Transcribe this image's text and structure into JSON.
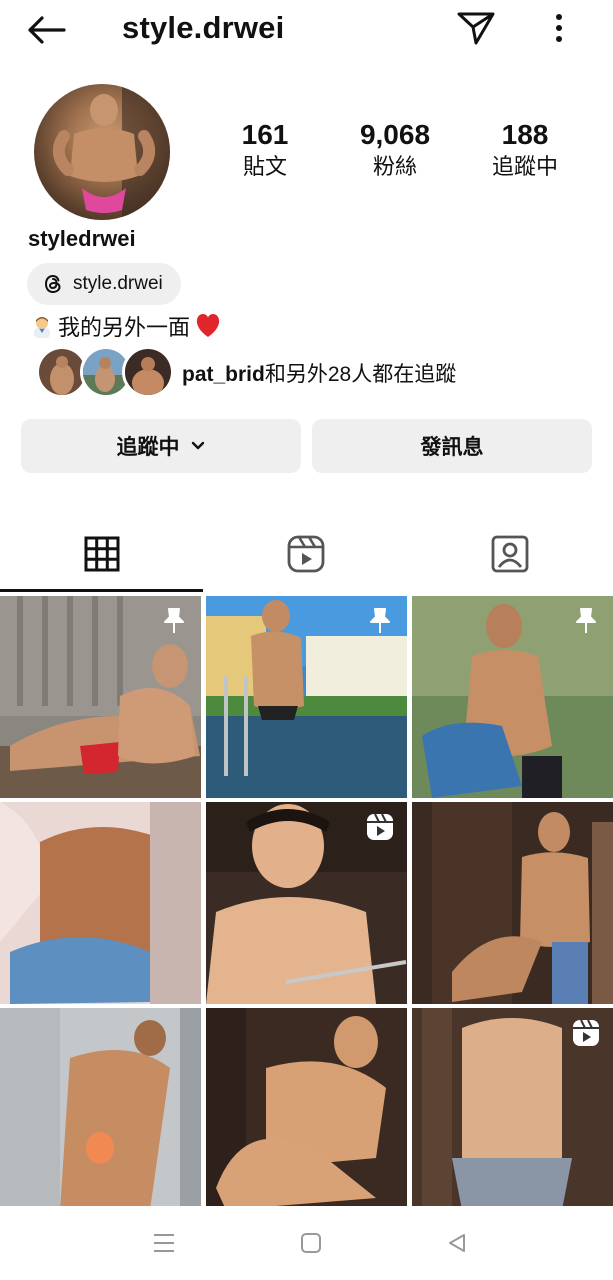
{
  "header": {
    "title": "style.drwei"
  },
  "profile": {
    "stats": [
      {
        "value": "161",
        "label": "貼文"
      },
      {
        "value": "9,068",
        "label": "粉絲"
      },
      {
        "value": "188",
        "label": "追蹤中"
      }
    ],
    "name": "styledrwei",
    "threads_handle": "style.drwei",
    "bio_text": "我的另外一面",
    "followed_by_user": "pat_brid",
    "followed_by_rest": "和另外28人都在追蹤"
  },
  "actions": {
    "following_label": "追蹤中",
    "message_label": "發訊息"
  },
  "tabs": [
    "grid-icon",
    "reels-icon",
    "tagged-icon"
  ],
  "grid": {
    "posts": [
      {
        "badge": "pin-icon"
      },
      {
        "badge": "pin-icon"
      },
      {
        "badge": "pin-icon"
      },
      {
        "badge": ""
      },
      {
        "badge": "reel-icon"
      },
      {
        "badge": ""
      },
      {
        "badge": ""
      },
      {
        "badge": ""
      },
      {
        "badge": "reel-icon"
      }
    ]
  },
  "nav": [
    "menu-icon",
    "home-icon",
    "back-icon"
  ]
}
